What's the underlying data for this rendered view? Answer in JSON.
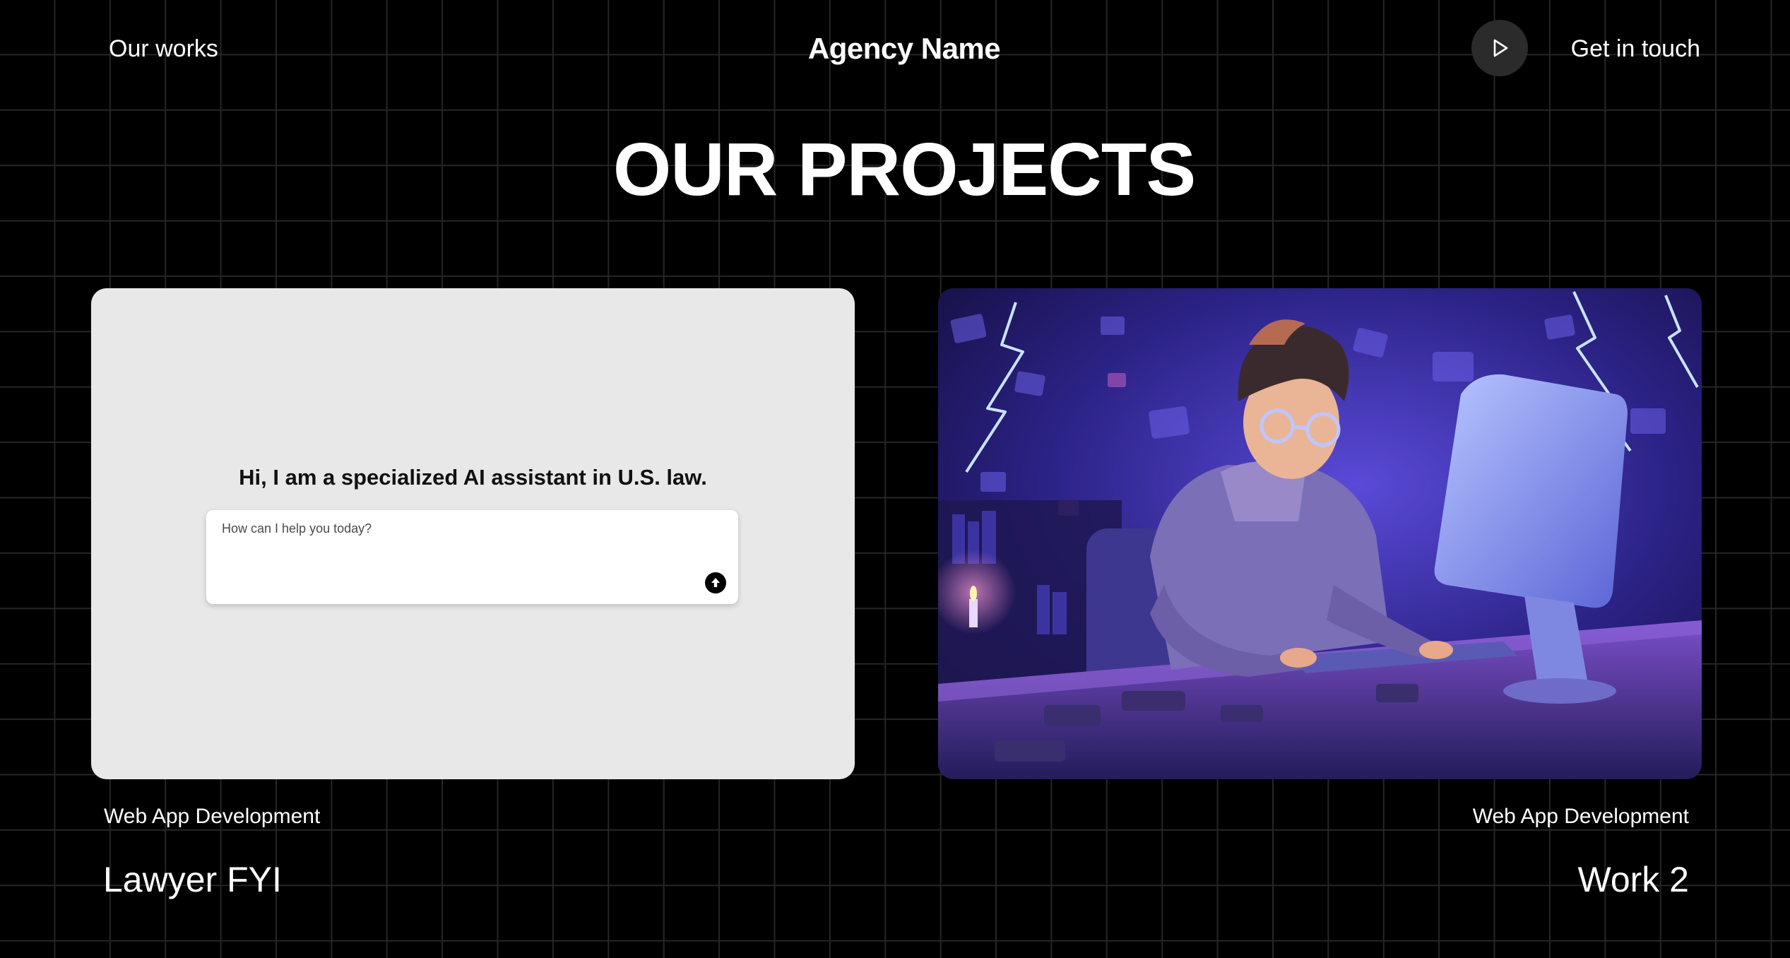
{
  "nav": {
    "left_link": "Our works",
    "brand": "Agency Name",
    "cta": "Get in touch",
    "play_icon": "play-icon"
  },
  "main": {
    "heading": "OUR PROJECTS"
  },
  "projects": [
    {
      "category": "Web App Development",
      "name": "Lawyer FYI",
      "preview": {
        "title": "Hi, I am a specialized AI assistant in U.S. law.",
        "input_placeholder": "How can I help you today?",
        "send_icon": "arrow-up-circle-icon"
      }
    },
    {
      "category": "Web App Development",
      "name": "Work 2",
      "image_description": "illustration of a young man with glasses typing at a computer in a dark purple room with lightning"
    }
  ],
  "colors": {
    "background": "#000000",
    "grid_line": "#262626",
    "text": "#ffffff",
    "card_light": "#e8e8e8",
    "accent_purple": "#5b3fd4"
  }
}
